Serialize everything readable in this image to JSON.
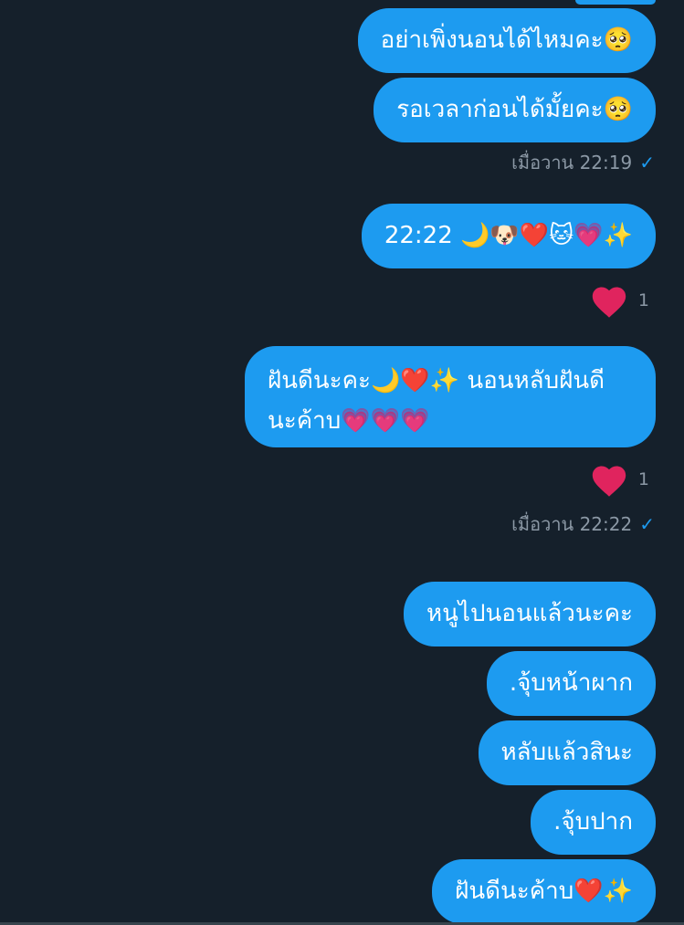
{
  "colors": {
    "background": "#15202b",
    "bubble": "#1d9bf0",
    "meta_text": "#8b98a5",
    "heart": "#e0245e"
  },
  "messages": [
    "อย่าเพิ่งนอนได้ไหมคะ🥺",
    "รอเวลาก่อนได้มั้ยคะ🥺",
    "22:22 🌙🐶❤️🐱💗✨",
    "ฝันดีนะคะ🌙❤️✨ นอนหลับฝันดีนะค้าบ💗💗💗",
    "หนูไปนอนแล้วนะคะ",
    ".จุ้บหน้าผาก",
    "หลับแล้วสินะ",
    ".จุ้บปาก",
    "ฝันดีนะค้าบ❤️✨"
  ],
  "timestamps": {
    "first": "เมื่อวาน 22:19",
    "second": "เมื่อวาน 22:22",
    "sent_check": "✓"
  },
  "reactions": [
    {
      "icon": "heart-icon",
      "count": "1"
    },
    {
      "icon": "heart-icon",
      "count": "1"
    }
  ]
}
